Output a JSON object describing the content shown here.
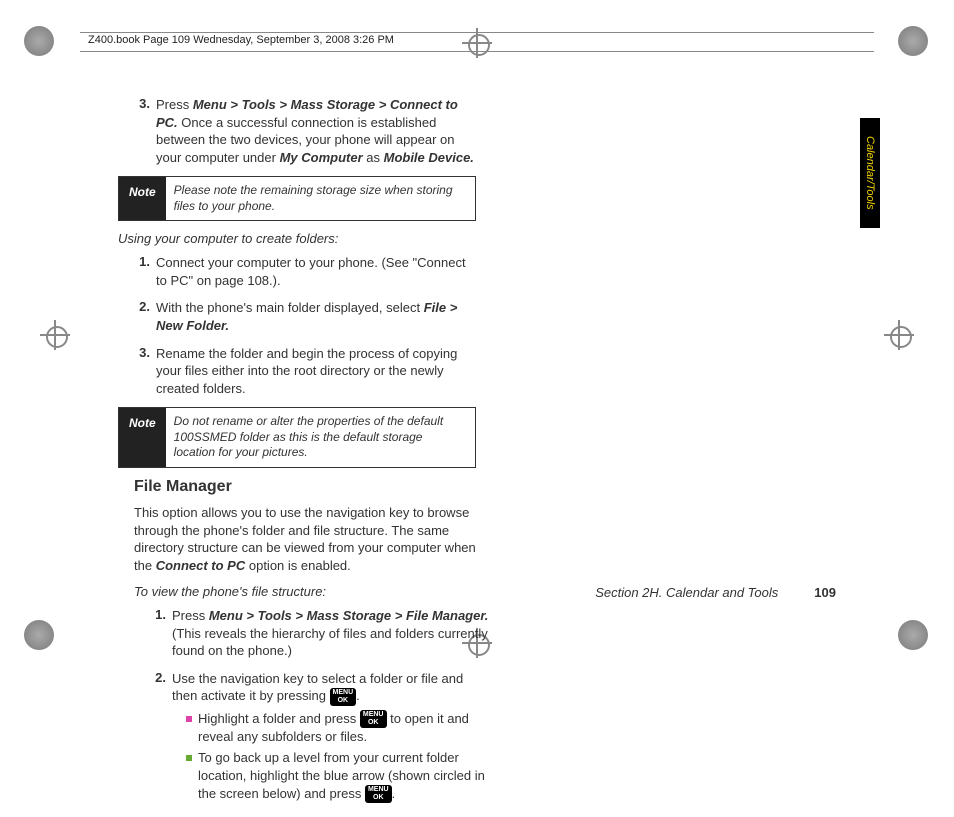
{
  "header": "Z400.book  Page 109  Wednesday, September 3, 2008  3:26 PM",
  "sideTab": "Calendar/Tools",
  "colA": {
    "step3": {
      "num": "3.",
      "pre": "Press ",
      "path": "Menu > Tools > Mass Storage > Connect to PC.",
      "rest": " Once a successful connection is established between the two devices, your phone will appear on your computer under ",
      "myComputer": "My Computer",
      "as": " as ",
      "mobileDevice": "Mobile Device."
    },
    "note1": {
      "label": "Note",
      "body": "Please note the remaining storage size when storing files to your phone."
    },
    "subHead": "Using your computer to create folders:",
    "b1": {
      "num": "1.",
      "text": "Connect your computer to your phone. (See \"Connect to PC\" on page 108.)."
    },
    "b2": {
      "num": "2.",
      "pre": "With the phone's main folder displayed, select ",
      "path": "File > New Folder."
    },
    "b3": {
      "num": "3.",
      "text": "Rename the folder and begin the process of copying your files either into the root directory or the newly created folders."
    },
    "note2": {
      "label": "Note",
      "body": "Do not rename or alter the properties of the default 100SSMED folder as this is the default storage location for your pictures."
    }
  },
  "colB": {
    "h3": "File Manager",
    "intro1": "This option allows you to use the navigation key to browse through the phone's folder and file structure. The same directory structure can be viewed from your computer when the ",
    "introBold": "Connect to PC",
    "intro2": " option is enabled.",
    "subHead": "To view the phone's file structure:",
    "s1": {
      "num": "1.",
      "pre": "Press ",
      "path": "Menu > Tools > Mass Storage > File Manager.",
      "rest": " (This reveals the hierarchy of files and folders currently found on the phone.)"
    },
    "s2": {
      "num": "2.",
      "pre": "Use the navigation key to select a folder or file and then activate it by pressing ",
      "post": "."
    },
    "bul1a": "Highlight a folder and press ",
    "bul1b": " to open it and reveal any subfolders or files.",
    "bul2a": "To go back up a level from your current folder location, highlight the blue arrow (shown circled in the screen below) and press",
    "bul2b": "."
  },
  "key": {
    "l1": "MENU",
    "l2": "OK"
  },
  "footer": {
    "section": "Section 2H. Calendar and Tools",
    "page": "109"
  }
}
